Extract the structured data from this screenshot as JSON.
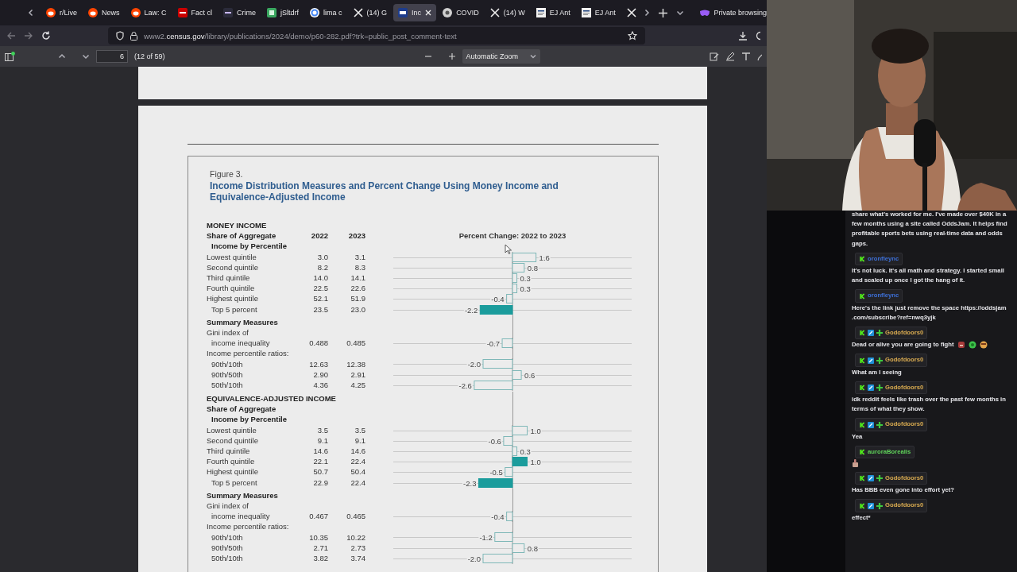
{
  "browser": {
    "tabs": [
      {
        "label": "r/Live",
        "kind": "reddit",
        "selected": false
      },
      {
        "label": "News",
        "kind": "reddit",
        "selected": false
      },
      {
        "label": "Law: C",
        "kind": "reddit",
        "selected": false
      },
      {
        "label": "Fact cl",
        "kind": "news",
        "selected": false
      },
      {
        "label": "Crime",
        "kind": "crime",
        "selected": false
      },
      {
        "label": "jSltdrf",
        "kind": "chat",
        "selected": false
      },
      {
        "label": "lima c",
        "kind": "search",
        "selected": false
      },
      {
        "label": "(14) G",
        "kind": "x",
        "selected": false
      },
      {
        "label": "Inc",
        "kind": "census",
        "selected": true
      },
      {
        "label": "COVID",
        "kind": "disc",
        "selected": false
      },
      {
        "label": "(14) W",
        "kind": "x",
        "selected": false
      },
      {
        "label": "EJ Ant",
        "kind": "document",
        "selected": false
      },
      {
        "label": "EJ Ant",
        "kind": "document",
        "selected": false
      },
      {
        "kind": "x",
        "selected": false
      }
    ],
    "private_label": "Private browsing",
    "url": {
      "subdomain": "www2.",
      "domain": "census.gov",
      "path": "/library/publications/2024/demo/p60-282.pdf?trk=public_post_comment-text"
    },
    "pdf": {
      "page": "6",
      "page_count": "(12 of 59)",
      "zoom": "Automatic Zoom"
    }
  },
  "figure": {
    "caption": "Figure 3.",
    "title": "Income Distribution Measures and Percent Change Using Money Income and Equivalence-Adjusted Income",
    "rows": [
      {
        "kind": "section",
        "label": "MONEY INCOME"
      },
      {
        "kind": "heading",
        "label": "Share of Aggregate",
        "y2022": "2022",
        "y2023": "2023",
        "chart_title": "Percent Change: 2022 to 2023"
      },
      {
        "kind": "subhead",
        "label": "Income by Percentile"
      },
      {
        "kind": "data",
        "label": "Lowest quintile",
        "indented": false,
        "y2022": "3.0",
        "y2023": "3.1",
        "change": "1.6",
        "significant": false
      },
      {
        "kind": "data",
        "label": "Second quintile",
        "indented": false,
        "y2022": "8.2",
        "y2023": "8.3",
        "change": "0.8",
        "significant": false
      },
      {
        "kind": "data",
        "label": "Third quintile",
        "indented": false,
        "y2022": "14.0",
        "y2023": "14.1",
        "change": "0.3",
        "significant": false
      },
      {
        "kind": "data",
        "label": "Fourth quintile",
        "indented": false,
        "y2022": "22.5",
        "y2023": "22.6",
        "change": "0.3",
        "significant": false
      },
      {
        "kind": "data",
        "label": "Highest quintile",
        "indented": false,
        "y2022": "52.1",
        "y2023": "51.9",
        "change": "-0.4",
        "significant": false
      },
      {
        "kind": "data",
        "label": "Top 5 percent",
        "indented": true,
        "y2022": "23.5",
        "y2023": "23.0",
        "change": "-2.2",
        "significant": true
      },
      {
        "kind": "group",
        "label": "Summary Measures"
      },
      {
        "kind": "label",
        "label": "Gini index of"
      },
      {
        "kind": "data",
        "label": "income inequality",
        "indented": true,
        "y2022": "0.488",
        "y2023": "0.485",
        "change": "-0.7",
        "significant": false
      },
      {
        "kind": "label",
        "label": "Income percentile ratios:"
      },
      {
        "kind": "data",
        "label": "90th/10th",
        "indented": true,
        "y2022": "12.63",
        "y2023": "12.38",
        "change": "-2.0",
        "significant": false
      },
      {
        "kind": "data",
        "label": "90th/50th",
        "indented": true,
        "y2022": "2.90",
        "y2023": "2.91",
        "change": "0.6",
        "significant": false
      },
      {
        "kind": "data",
        "label": "50th/10th",
        "indented": true,
        "y2022": "4.36",
        "y2023": "4.25",
        "change": "-2.6",
        "significant": false
      },
      {
        "kind": "section",
        "label": "EQUIVALENCE-ADJUSTED INCOME"
      },
      {
        "kind": "heading",
        "label": "Share of Aggregate"
      },
      {
        "kind": "subhead",
        "label": "Income by Percentile"
      },
      {
        "kind": "data",
        "label": "Lowest quintile",
        "indented": false,
        "y2022": "3.5",
        "y2023": "3.5",
        "change": "1.0",
        "significant": false
      },
      {
        "kind": "data",
        "label": "Second quintile",
        "indented": false,
        "y2022": "9.1",
        "y2023": "9.1",
        "change": "-0.6",
        "significant": false
      },
      {
        "kind": "data",
        "label": "Third quintile",
        "indented": false,
        "y2022": "14.6",
        "y2023": "14.6",
        "change": "0.3",
        "significant": false
      },
      {
        "kind": "data",
        "label": "Fourth quintile",
        "indented": false,
        "y2022": "22.1",
        "y2023": "22.4",
        "change": "1.0",
        "significant": true
      },
      {
        "kind": "data",
        "label": "Highest quintile",
        "indented": false,
        "y2022": "50.7",
        "y2023": "50.4",
        "change": "-0.5",
        "significant": false
      },
      {
        "kind": "data",
        "label": "Top 5 percent",
        "indented": true,
        "y2022": "22.9",
        "y2023": "22.4",
        "change": "-2.3",
        "significant": true
      },
      {
        "kind": "group",
        "label": "Summary Measures"
      },
      {
        "kind": "label",
        "label": "Gini index of"
      },
      {
        "kind": "data",
        "label": "income inequality",
        "indented": true,
        "y2022": "0.467",
        "y2023": "0.465",
        "change": "-0.4",
        "significant": false
      },
      {
        "kind": "label",
        "label": "Income percentile ratios:"
      },
      {
        "kind": "data",
        "label": "90th/10th",
        "indented": true,
        "y2022": "10.35",
        "y2023": "10.22",
        "change": "-1.2",
        "significant": false
      },
      {
        "kind": "data",
        "label": "90th/50th",
        "indented": true,
        "y2022": "2.71",
        "y2023": "2.73",
        "change": "0.8",
        "significant": false
      },
      {
        "kind": "data",
        "label": "50th/10th",
        "indented": true,
        "y2022": "3.82",
        "y2023": "3.74",
        "change": "-2.0",
        "significant": false
      }
    ]
  },
  "chat": {
    "messages": [
      {
        "text": "share what's worked for me. I've made over $40K in a few months using a site called OddsJam. It helps find profitable sports bets using real-time data and odds gaps."
      },
      {
        "user": "oronfleync",
        "color": "#3d6fd6",
        "badges": [
          {
            "kind": "k"
          }
        ],
        "text": "It's not luck. It's all math and strategy. I started small and scaled up once I got the hang of it."
      },
      {
        "user": "oronfleync",
        "color": "#3d6fd6",
        "badges": [
          {
            "kind": "k"
          }
        ],
        "text": "Here's the link just remove the space https://oddsjam .com/subscribe?ref=nwq3yjk"
      },
      {
        "user": "Godofdoors0",
        "color": "#d9ab50",
        "badges": [
          {
            "kind": "k"
          },
          {
            "kind": "moderator"
          },
          {
            "kind": "plus"
          }
        ],
        "text": "Dead or alive you are going to fight",
        "emotes": [
          {
            "kind": "box"
          },
          {
            "kind": "blob"
          },
          {
            "kind": "face"
          }
        ]
      },
      {
        "user": "Godofdoors0",
        "color": "#d9ab50",
        "badges": [
          {
            "kind": "k"
          },
          {
            "kind": "moderator"
          },
          {
            "kind": "plus"
          }
        ],
        "text": "What am I seeing"
      },
      {
        "user": "Godofdoors0",
        "color": "#d9ab50",
        "badges": [
          {
            "kind": "k"
          },
          {
            "kind": "moderator"
          },
          {
            "kind": "plus"
          }
        ],
        "text": "idk reddit feels like trash over the past few months in terms of what they show."
      },
      {
        "user": "Godofdoors0",
        "color": "#d9ab50",
        "badges": [
          {
            "kind": "k"
          },
          {
            "kind": "moderator"
          },
          {
            "kind": "plus"
          }
        ],
        "text": "Yea"
      },
      {
        "user": "auroraBorealis",
        "color": "#5fd35a",
        "badges": [
          {
            "kind": "k"
          }
        ],
        "emotes": [
          {
            "kind": "thumb"
          }
        ]
      },
      {
        "user": "Godofdoors0",
        "color": "#d9ab50",
        "badges": [
          {
            "kind": "k"
          },
          {
            "kind": "moderator"
          },
          {
            "kind": "plus"
          }
        ],
        "text": "Has BBB even gone into effort yet?"
      },
      {
        "user": "Godofdoors0",
        "color": "#d9ab50",
        "badges": [
          {
            "kind": "k"
          },
          {
            "kind": "moderator"
          },
          {
            "kind": "plus"
          }
        ],
        "text": "effect*"
      }
    ]
  }
}
